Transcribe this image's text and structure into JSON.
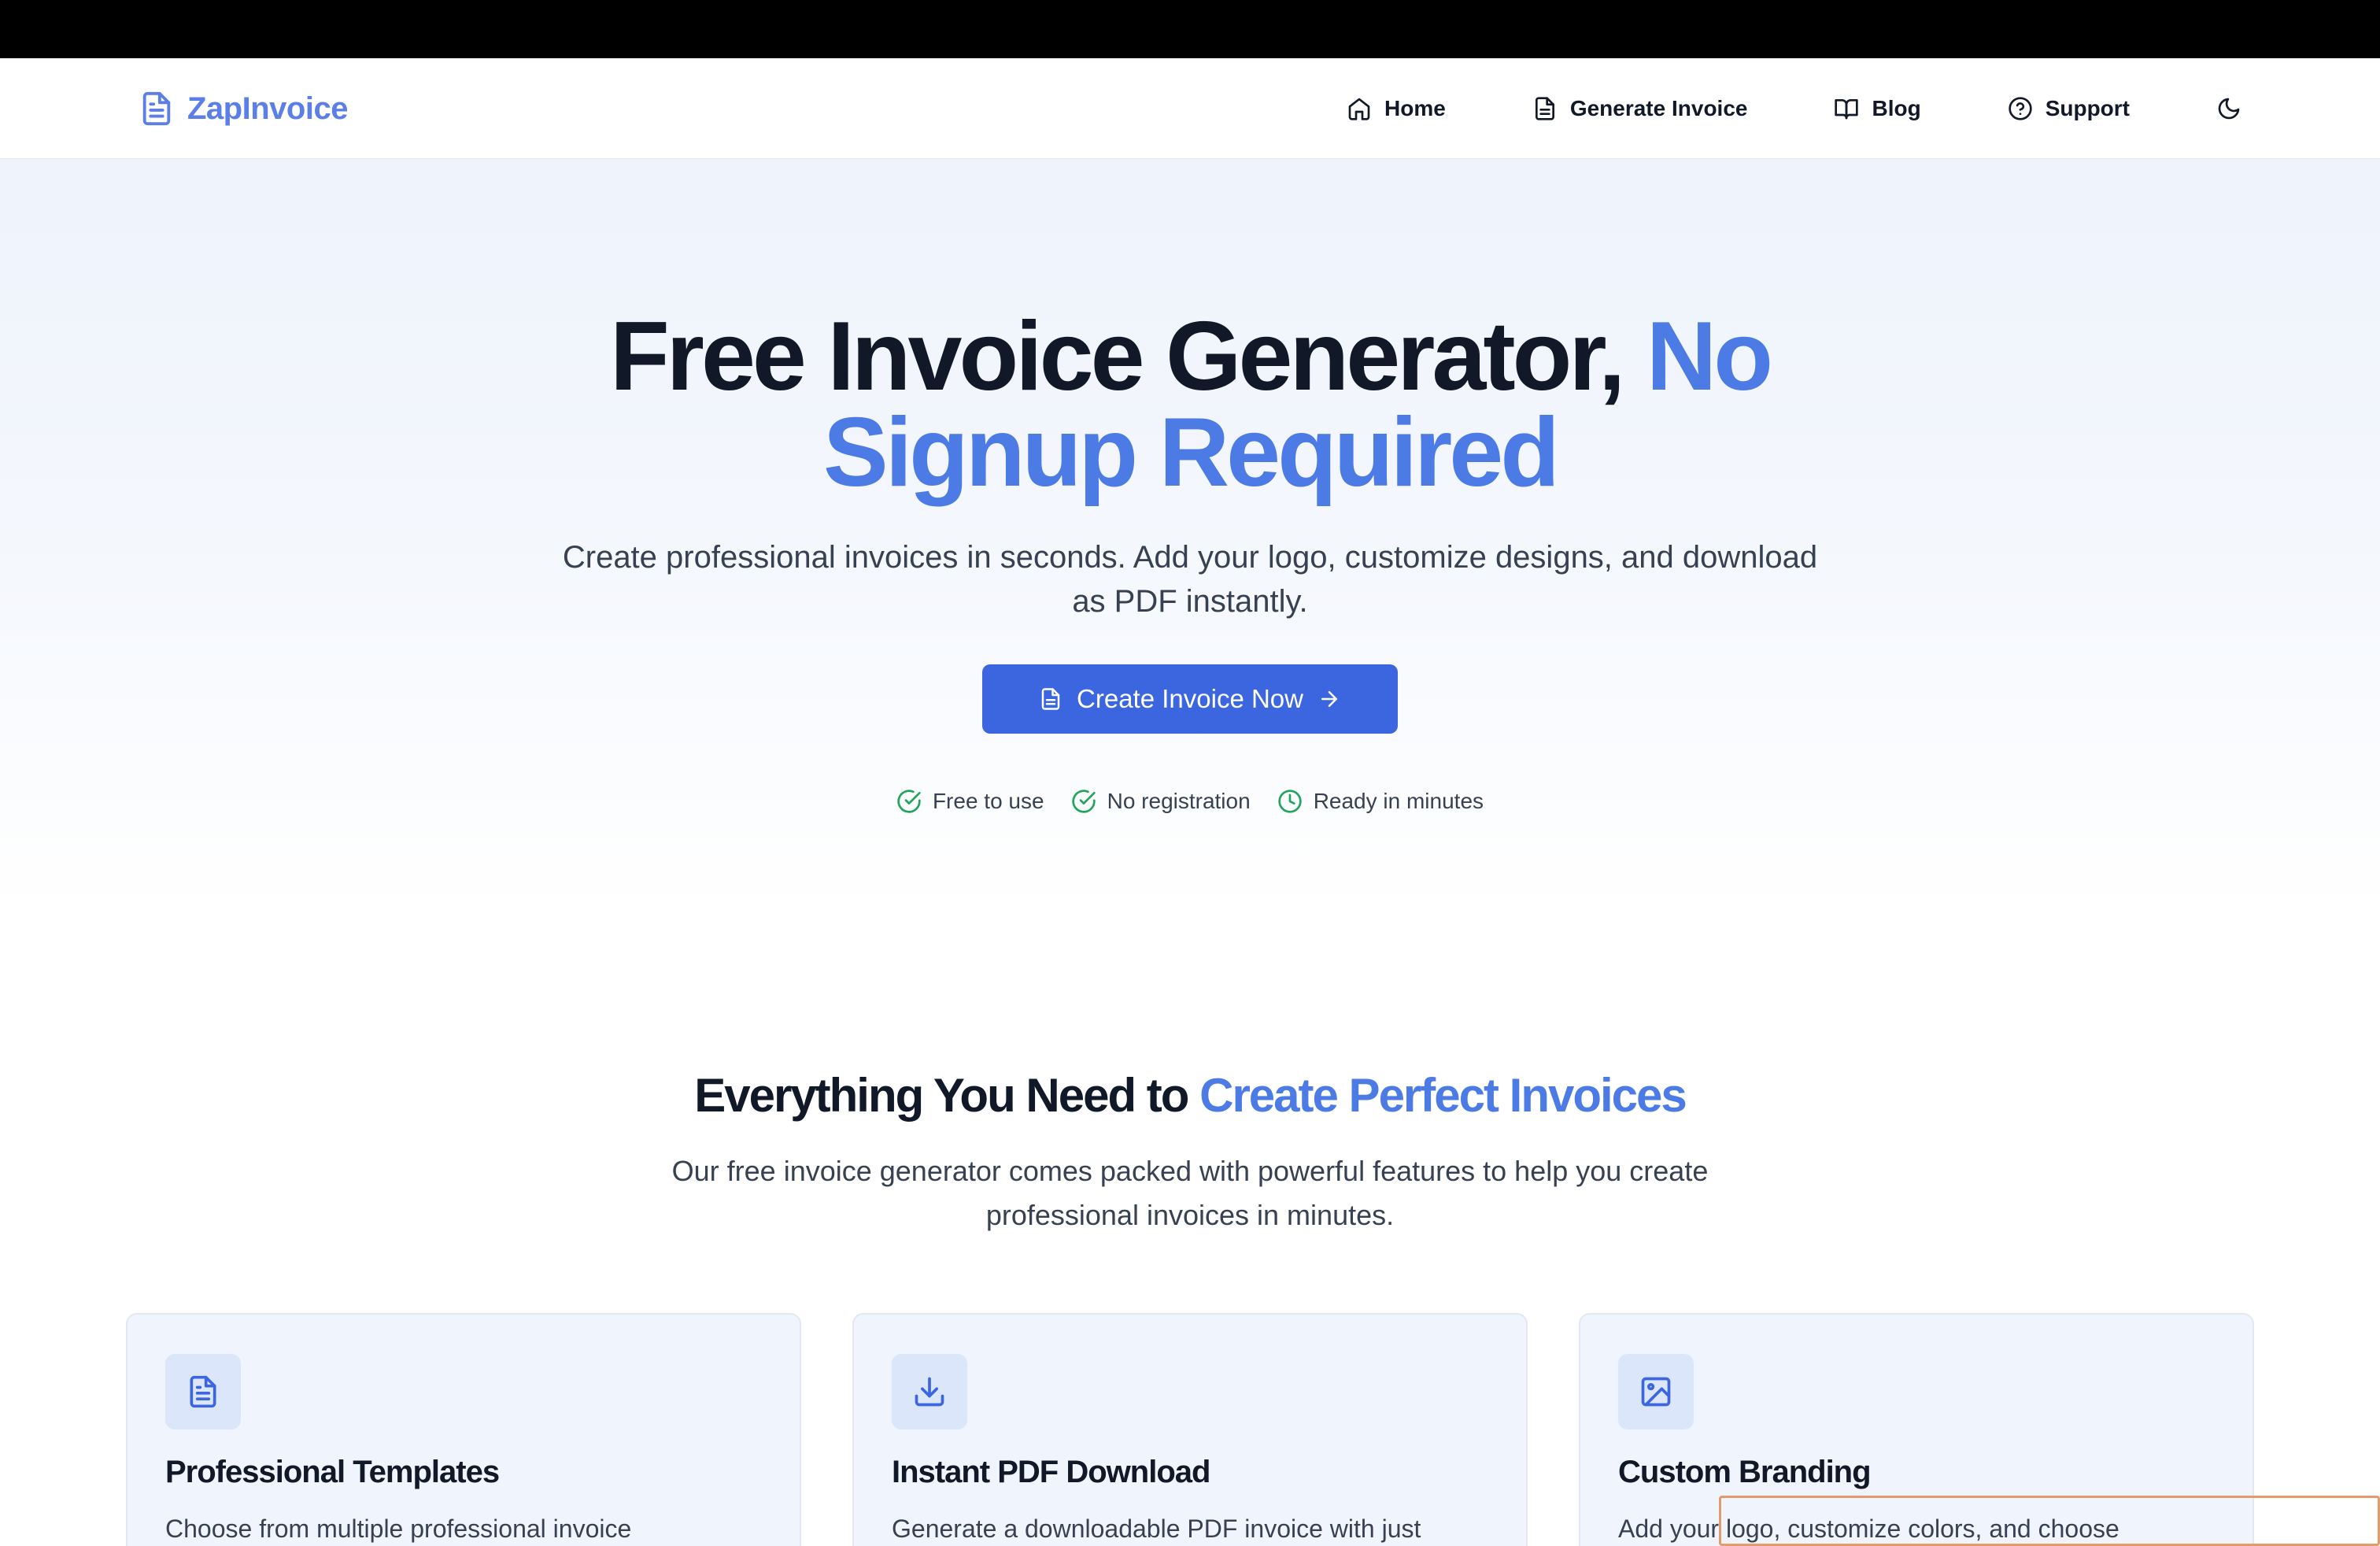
{
  "brand": {
    "name": "ZapInvoice",
    "color": "#5b7fe6"
  },
  "nav": {
    "items": [
      {
        "label": "Home",
        "icon": "home-icon"
      },
      {
        "label": "Generate Invoice",
        "icon": "document-icon"
      },
      {
        "label": "Blog",
        "icon": "book-icon"
      },
      {
        "label": "Support",
        "icon": "help-circle-icon"
      }
    ],
    "theme_toggle_icon": "moon-icon"
  },
  "hero": {
    "title_main": "Free Invoice Generator,",
    "title_accent_1": "No",
    "title_accent_2": "Signup Required",
    "subtitle": "Create professional invoices in seconds. Add your logo, customize designs, and download as PDF instantly.",
    "cta_label": "Create Invoice Now",
    "badges": [
      {
        "label": "Free to use",
        "icon": "check-circle-icon"
      },
      {
        "label": "No registration",
        "icon": "check-circle-icon"
      },
      {
        "label": "Ready in minutes",
        "icon": "clock-icon"
      }
    ]
  },
  "features": {
    "title_main": "Everything You Need to",
    "title_accent": "Create Perfect Invoices",
    "subtitle": "Our free invoice generator comes packed with powerful features to help you create professional invoices in minutes.",
    "cards": [
      {
        "title": "Professional Templates",
        "description": "Choose from multiple professional invoice",
        "icon": "document-icon"
      },
      {
        "title": "Instant PDF Download",
        "description": "Generate a downloadable PDF invoice with just",
        "icon": "download-icon"
      },
      {
        "title": "Custom Branding",
        "description": "Add your logo, customize colors, and choose",
        "icon": "image-icon"
      }
    ]
  },
  "colors": {
    "accent": "#4c7be6",
    "cta": "#3b66e0",
    "success": "#22a55b",
    "heading": "#111827"
  }
}
